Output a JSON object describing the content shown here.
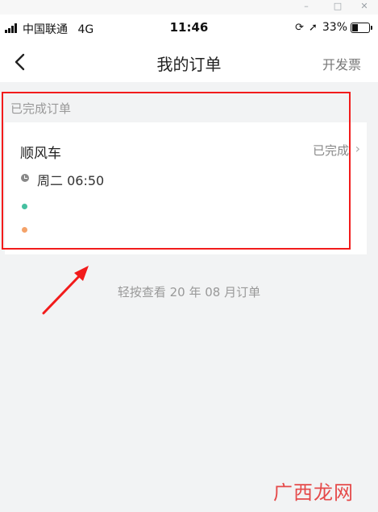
{
  "window_controls": {
    "minimize": "–",
    "maximize": "□",
    "close": "✕"
  },
  "status_bar": {
    "carrier": "中国联通",
    "network": "4G",
    "time": "11:46",
    "battery": "33%",
    "battery_level": 0.33,
    "icons": [
      "rotation-lock-icon",
      "location-arrow-icon",
      "battery-icon"
    ]
  },
  "nav": {
    "back_icon": "chevron-left-icon",
    "title": "我的订单",
    "action": "开发票"
  },
  "section": {
    "title": "已完成订单"
  },
  "order": {
    "service": "顺风车",
    "status": "已完成",
    "time": "周二 06:50"
  },
  "footer": {
    "hint": "轻按查看 20 年 08 月订单"
  },
  "watermark": {
    "text": "广西龙网"
  },
  "colors": {
    "highlight": "#f21b1b",
    "start_dot": "#45c0a0",
    "end_dot": "#f4a269",
    "background": "#f2f3f4"
  }
}
